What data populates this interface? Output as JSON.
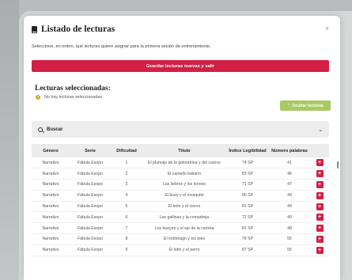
{
  "modal": {
    "title": "Listado de lecturas",
    "close_glyph": "×",
    "subtitle": "Seleccione, en orden, qué lecturas quiere asignar para la primera sesión de entrenamiento.",
    "save_label": "Guardar lecturas nuevas y salir"
  },
  "selected": {
    "title": "Lecturas seleccionadas:",
    "empty_message": "No hay lecturas seleccionadas",
    "hide_label": "Ocultar lecturas"
  },
  "search": {
    "label": "Buscar"
  },
  "table": {
    "columns": [
      "Género",
      "Serie",
      "Dificultad",
      "Título",
      "Índice Legibilidad",
      "Número palabras"
    ],
    "rows": [
      [
        "Narrativo",
        "Fábula Esopo",
        "1",
        "El plumaje de la golondrina y del cuervo",
        "74 SP",
        "41"
      ],
      [
        "Narrativo",
        "Fábula Esopo",
        "2",
        "El camello bailarín",
        "83 SP",
        "46"
      ],
      [
        "Narrativo",
        "Fábula Esopo",
        "3",
        "Las liebres y los leones",
        "71 SP",
        "47"
      ],
      [
        "Narrativo",
        "Fábula Esopo",
        "4",
        "El buey y el mosquito",
        "90 SP",
        "49"
      ],
      [
        "Narrativo",
        "Fábula Esopo",
        "5",
        "El león y el ciervo",
        "81 SP",
        "49"
      ],
      [
        "Narrativo",
        "Fábula Esopo",
        "6",
        "Las gallinas y la comadreja",
        "72 SP",
        "49"
      ],
      [
        "Narrativo",
        "Fábula Esopo",
        "7",
        "Los bueyes y el eje de la carreta",
        "81 SP",
        "48"
      ],
      [
        "Narrativo",
        "Fábula Esopo",
        "8",
        "El estómago y los pies",
        "78 SP",
        "55"
      ],
      [
        "Narrativo",
        "Fábula Esopo",
        "9",
        "El lobo y el perro",
        "87 SP",
        "55"
      ]
    ],
    "add_glyph": "+"
  },
  "colors": {
    "primary_red": "#d31f45",
    "green": "#a9c962",
    "warning": "#c9ae2c"
  }
}
